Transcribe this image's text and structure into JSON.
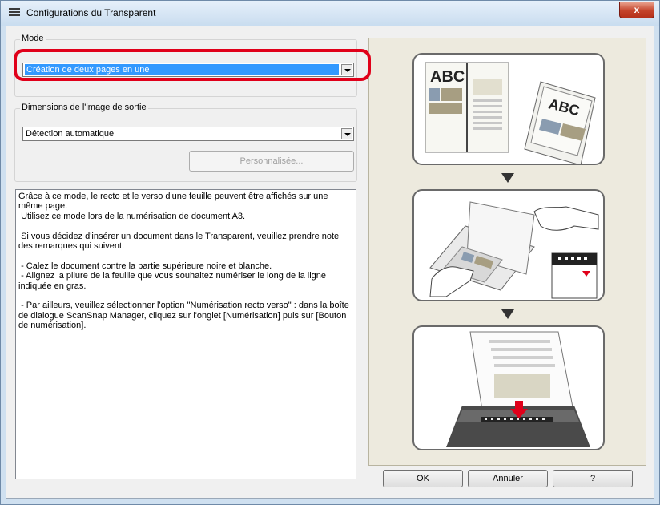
{
  "window": {
    "title": "Configurations du Transparent",
    "close_label": "x"
  },
  "mode": {
    "group_label": "Mode",
    "selected": "Création de deux pages en une"
  },
  "output_size": {
    "group_label": "Dimensions de l'image de sortie",
    "selected": "Détection automatique",
    "custom_button": "Personnalisée..."
  },
  "description": "Grâce à ce mode, le recto et le verso d'une feuille peuvent être affichés sur une même page.\n Utilisez ce mode lors de la numérisation de document A3.\n\n Si vous décidez d'insérer un document dans le Transparent, veuillez prendre note des remarques qui suivent.\n\n - Calez le document contre la partie supérieure noire et blanche.\n - Alignez la pliure de la feuille que vous souhaitez numériser le long de la ligne indiquée en gras.\n\n - Par ailleurs, veuillez sélectionner l'option \"Numérisation recto verso\" : dans la boîte de dialogue ScanSnap Manager, cliquez sur l'onglet [Numérisation] puis sur [Bouton de numérisation].",
  "illustration": {
    "text_abc": "ABC"
  },
  "buttons": {
    "ok": "OK",
    "cancel": "Annuler",
    "help": "?"
  },
  "colors": {
    "highlight": "#e0001a",
    "selection": "#3399ff"
  }
}
